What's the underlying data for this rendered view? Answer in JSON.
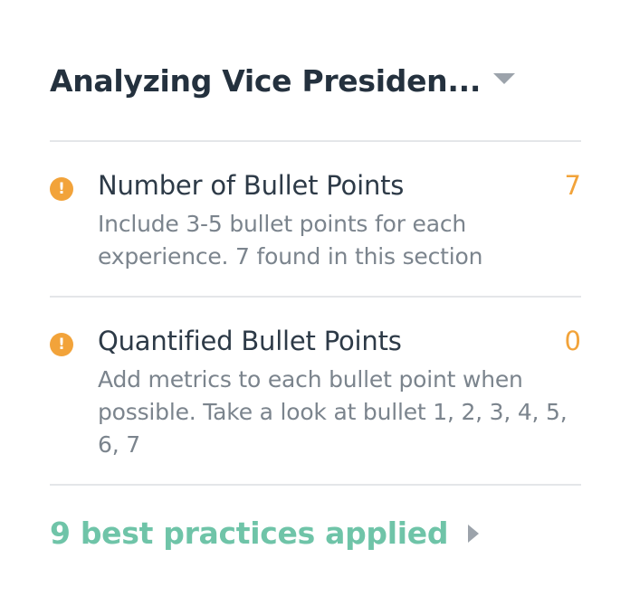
{
  "header": {
    "title": "Analyzing Vice Presiden...",
    "dropdown_icon": "caret-down-icon"
  },
  "checks": [
    {
      "icon": "warning-icon",
      "icon_glyph": "!",
      "title": "Number of Bullet Points",
      "count": "7",
      "description": "Include 3-5 bullet points for each experience. 7 found in this section"
    },
    {
      "icon": "warning-icon",
      "icon_glyph": "!",
      "title": "Quantified Bullet Points",
      "count": "0",
      "description": "Add metrics to each bullet point when possible. Take a look at bullet 1, 2, 3, 4, 5, 6, 7"
    }
  ],
  "footer": {
    "label": "9 best practices applied",
    "arrow_icon": "caret-right-icon"
  },
  "colors": {
    "warning": "#f2a33a",
    "success": "#6fc4a8",
    "title_text": "#24313e",
    "description_text": "#7b848d",
    "divider": "#e4e6e9"
  }
}
